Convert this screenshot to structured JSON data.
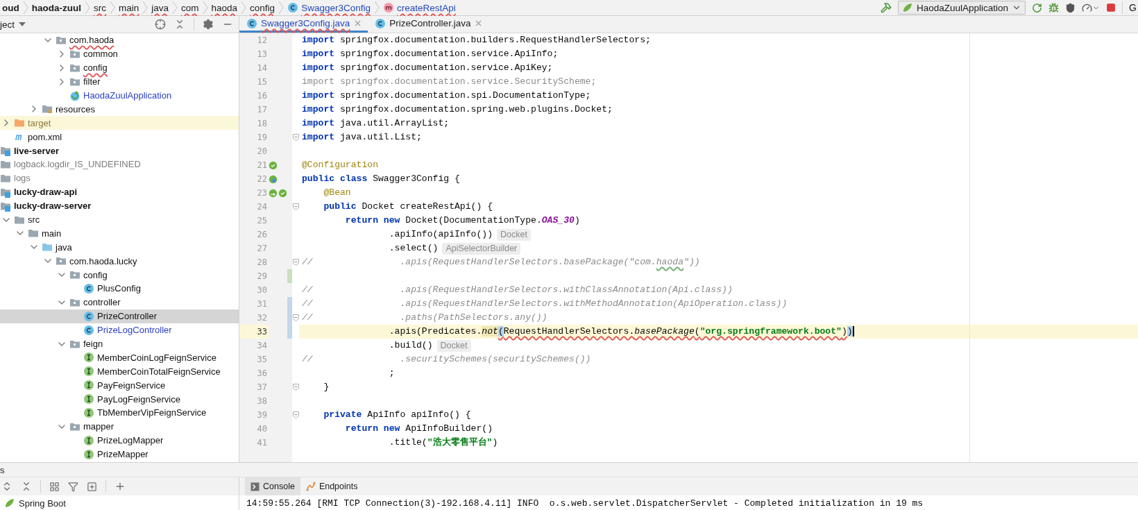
{
  "breadcrumbs": [
    {
      "label": "oud",
      "kind": "module",
      "error": false
    },
    {
      "label": "haoda-zuul",
      "kind": "module",
      "error": false
    },
    {
      "label": "src",
      "kind": "folder",
      "error": true
    },
    {
      "label": "main",
      "kind": "folder",
      "error": true
    },
    {
      "label": "java",
      "kind": "folder",
      "error": true
    },
    {
      "label": "com",
      "kind": "folder",
      "error": true
    },
    {
      "label": "haoda",
      "kind": "folder",
      "error": true
    },
    {
      "label": "config",
      "kind": "folder",
      "error": true
    },
    {
      "label": "Swagger3Config",
      "kind": "class",
      "error": true
    },
    {
      "label": "createRestApi",
      "kind": "method",
      "error": true
    }
  ],
  "run_toolbar": {
    "configuration": "HaodaZuulApplication",
    "overflow_text": "G"
  },
  "project_panel": {
    "title": "ject",
    "tree": [
      {
        "children": [
          {
            "children": [
              {
                "children": [
                  {
                    "children": [
                      {
                        "label": "com.haoda",
                        "kind": "package",
                        "expanded": true,
                        "selected": false,
                        "modified": false,
                        "ignored": false,
                        "dimmed": false,
                        "error": true,
                        "children": [
                          {
                            "label": "common",
                            "kind": "package",
                            "expanded": false,
                            "selected": false,
                            "modified": false,
                            "ignored": false,
                            "dimmed": false,
                            "error": false
                          },
                          {
                            "label": "config",
                            "kind": "package",
                            "expanded": false,
                            "selected": false,
                            "modified": false,
                            "ignored": false,
                            "dimmed": false,
                            "error": true
                          },
                          {
                            "label": "filter",
                            "kind": "package",
                            "expanded": false,
                            "selected": false,
                            "modified": false,
                            "ignored": false,
                            "dimmed": false,
                            "error": false
                          },
                          {
                            "label": "HaodaZuulApplication",
                            "kind": "spring-class",
                            "selected": false,
                            "modified": true,
                            "ignored": false,
                            "dimmed": false,
                            "error": false
                          }
                        ]
                      }
                    ]
                  },
                  {
                    "label": "resources",
                    "kind": "resources-folder",
                    "expanded": false,
                    "selected": false,
                    "modified": false,
                    "ignored": false,
                    "dimmed": false,
                    "error": false
                  }
                ]
              }
            ]
          },
          {
            "label": "target",
            "kind": "excluded-folder",
            "expanded": false,
            "selected": false,
            "modified": false,
            "ignored": true,
            "dimmed": false,
            "error": false
          },
          {
            "label": "pom.xml",
            "kind": "maven",
            "selected": false,
            "modified": false,
            "ignored": false,
            "dimmed": false,
            "error": false
          }
        ]
      },
      {
        "label": "live-server",
        "kind": "module",
        "selected": false,
        "modified": false,
        "ignored": false,
        "dimmed": false,
        "error": false
      },
      {
        "label": "logback.logdir_IS_UNDEFINED",
        "kind": "folder",
        "selected": false,
        "modified": false,
        "ignored": false,
        "dimmed": true,
        "error": false
      },
      {
        "label": "logs",
        "kind": "folder",
        "selected": false,
        "modified": false,
        "ignored": false,
        "dimmed": true,
        "error": false
      },
      {
        "label": "lucky-draw-api",
        "kind": "module",
        "selected": false,
        "modified": false,
        "ignored": false,
        "dimmed": false,
        "error": false
      },
      {
        "label": "lucky-draw-server",
        "kind": "module",
        "selected": false,
        "modified": false,
        "ignored": false,
        "dimmed": false,
        "error": false,
        "children": [
          {
            "label": "src",
            "kind": "folder",
            "expanded": true,
            "selected": false,
            "modified": false,
            "ignored": false,
            "dimmed": false,
            "error": false,
            "children": [
              {
                "label": "main",
                "kind": "folder",
                "expanded": true,
                "selected": false,
                "modified": false,
                "ignored": false,
                "dimmed": false,
                "error": false,
                "children": [
                  {
                    "label": "java",
                    "kind": "source-folder",
                    "expanded": true,
                    "selected": false,
                    "modified": false,
                    "ignored": false,
                    "dimmed": false,
                    "error": false,
                    "children": [
                      {
                        "label": "com.haoda.lucky",
                        "kind": "package",
                        "expanded": true,
                        "selected": false,
                        "modified": false,
                        "ignored": false,
                        "dimmed": false,
                        "error": false,
                        "children": [
                          {
                            "label": "config",
                            "kind": "package",
                            "expanded": true,
                            "selected": false,
                            "modified": false,
                            "ignored": false,
                            "dimmed": false,
                            "error": false,
                            "children": [
                              {
                                "label": "PlusConfig",
                                "kind": "class",
                                "selected": false,
                                "modified": false,
                                "ignored": false,
                                "dimmed": false,
                                "error": false
                              }
                            ]
                          },
                          {
                            "label": "controller",
                            "kind": "package",
                            "expanded": true,
                            "selected": false,
                            "modified": false,
                            "ignored": false,
                            "dimmed": false,
                            "error": false,
                            "children": [
                              {
                                "label": "PrizeController",
                                "kind": "class",
                                "selected": true,
                                "modified": false,
                                "ignored": false,
                                "dimmed": false,
                                "error": false
                              },
                              {
                                "label": "PrizeLogController",
                                "kind": "class",
                                "selected": false,
                                "modified": true,
                                "ignored": false,
                                "dimmed": false,
                                "error": false
                              }
                            ]
                          },
                          {
                            "label": "feign",
                            "kind": "package",
                            "expanded": true,
                            "selected": false,
                            "modified": false,
                            "ignored": false,
                            "dimmed": false,
                            "error": false,
                            "children": [
                              {
                                "label": "MemberCoinLogFeignService",
                                "kind": "interface",
                                "selected": false,
                                "modified": false,
                                "ignored": false,
                                "dimmed": false,
                                "error": false
                              },
                              {
                                "label": "MemberCoinTotalFeignService",
                                "kind": "interface",
                                "selected": false,
                                "modified": false,
                                "ignored": false,
                                "dimmed": false,
                                "error": false
                              },
                              {
                                "label": "PayFeignService",
                                "kind": "interface",
                                "selected": false,
                                "modified": false,
                                "ignored": false,
                                "dimmed": false,
                                "error": false
                              },
                              {
                                "label": "PayLogFeignService",
                                "kind": "interface",
                                "selected": false,
                                "modified": false,
                                "ignored": false,
                                "dimmed": false,
                                "error": false
                              },
                              {
                                "label": "TbMemberVipFeignService",
                                "kind": "interface",
                                "selected": false,
                                "modified": false,
                                "ignored": false,
                                "dimmed": false,
                                "error": false
                              }
                            ]
                          },
                          {
                            "label": "mapper",
                            "kind": "package",
                            "expanded": true,
                            "selected": false,
                            "modified": false,
                            "ignored": false,
                            "dimmed": false,
                            "error": false,
                            "children": [
                              {
                                "label": "PrizeLogMapper",
                                "kind": "interface",
                                "selected": false,
                                "modified": false,
                                "ignored": false,
                                "dimmed": false,
                                "error": false
                              },
                              {
                                "label": "PrizeMapper",
                                "kind": "interface",
                                "selected": false,
                                "modified": false,
                                "ignored": false,
                                "dimmed": false,
                                "error": false
                              }
                            ]
                          }
                        ]
                      }
                    ]
                  }
                ]
              }
            ]
          }
        ]
      }
    ]
  },
  "editor": {
    "tabs": [
      {
        "label": "Swagger3Config.java",
        "kind": "class",
        "selected": true,
        "error": true
      },
      {
        "label": "PrizeController.java",
        "kind": "class",
        "selected": false,
        "error": false
      }
    ],
    "lines": [
      {
        "number": "12",
        "kind": "plain",
        "tokens": [
          {
            "kind": "keyword",
            "text": "import"
          },
          {
            "kind": "plain",
            "text": " springfox.documentation.builders.RequestHandlerSelectors;"
          }
        ]
      },
      {
        "number": "13",
        "kind": "plain",
        "tokens": [
          {
            "kind": "keyword",
            "text": "import"
          },
          {
            "kind": "plain",
            "text": " springfox.documentation.service.ApiInfo;"
          }
        ]
      },
      {
        "number": "14",
        "kind": "plain",
        "tokens": [
          {
            "kind": "keyword",
            "text": "import"
          },
          {
            "kind": "plain",
            "text": " springfox.documentation.service.ApiKey;"
          }
        ]
      },
      {
        "number": "15",
        "kind": "plain",
        "tokens": [
          {
            "kind": "unused",
            "text": "import springfox.documentation.service.SecurityScheme;"
          }
        ]
      },
      {
        "number": "16",
        "kind": "plain",
        "tokens": [
          {
            "kind": "keyword",
            "text": "import"
          },
          {
            "kind": "plain",
            "text": " springfox.documentation.spi.DocumentationType;"
          }
        ]
      },
      {
        "number": "17",
        "kind": "plain",
        "tokens": [
          {
            "kind": "keyword",
            "text": "import"
          },
          {
            "kind": "plain",
            "text": " springfox.documentation.spring.web.plugins.Docket;"
          }
        ]
      },
      {
        "number": "18",
        "kind": "plain",
        "tokens": [
          {
            "kind": "keyword",
            "text": "import"
          },
          {
            "kind": "plain",
            "text": " java.util.ArrayList;"
          }
        ]
      },
      {
        "number": "19",
        "kind": "plain",
        "fold": true,
        "tokens": [
          {
            "kind": "keyword",
            "text": "import"
          },
          {
            "kind": "plain",
            "text": " java.util.List;"
          }
        ]
      },
      {
        "number": "20",
        "kind": "plain"
      },
      {
        "number": "21",
        "kind": "plain",
        "gutter": [
          {
            "kind": "spring-config"
          }
        ],
        "tokens": [
          {
            "kind": "annotation",
            "text": "@Configuration"
          }
        ]
      },
      {
        "number": "22",
        "kind": "plain",
        "gutter": [
          {
            "kind": "spring-bean"
          }
        ],
        "tokens": [
          {
            "kind": "keyword",
            "text": "public class"
          },
          {
            "kind": "plain",
            "text": " Swagger3Config {"
          }
        ]
      },
      {
        "number": "23",
        "kind": "plain",
        "gutter": [
          {
            "kind": "bean-link"
          },
          {
            "kind": "spring-config"
          }
        ],
        "tokens": [
          {
            "kind": "annotation",
            "text": "    @Bean"
          }
        ]
      },
      {
        "number": "24",
        "kind": "plain",
        "fold": true,
        "tokens": [
          {
            "kind": "keyword",
            "text": "    public"
          },
          {
            "kind": "plain",
            "text": " Docket createRestApi() {"
          }
        ]
      },
      {
        "number": "25",
        "kind": "plain",
        "tokens": [
          {
            "kind": "keyword",
            "text": "        return new"
          },
          {
            "kind": "plain",
            "text": " Docket(DocumentationType."
          },
          {
            "kind": "static-field",
            "text": "OAS_30"
          },
          {
            "kind": "plain",
            "text": ")"
          }
        ]
      },
      {
        "number": "26",
        "kind": "plain",
        "tokens": [
          {
            "kind": "plain",
            "text": "                .apiInfo(apiInfo())"
          }
        ],
        "hint": "Docket"
      },
      {
        "number": "27",
        "kind": "plain",
        "tokens": [
          {
            "kind": "plain",
            "text": "                .select()"
          }
        ],
        "hint": "ApiSelectorBuilder"
      },
      {
        "number": "28",
        "kind": "plain",
        "fold": true,
        "tokens": [
          {
            "kind": "comment",
            "text": "//                .apis(RequestHandlerSelectors.basePackage(\"com."
          },
          {
            "kind": "comment-typo",
            "text": "haoda"
          },
          {
            "kind": "comment",
            "text": "\"))"
          }
        ]
      },
      {
        "number": "29",
        "kind": "added"
      },
      {
        "number": "30",
        "kind": "plain",
        "tokens": [
          {
            "kind": "comment",
            "text": "//                .apis(RequestHandlerSelectors.withClassAnnotation(Api.class))"
          }
        ]
      },
      {
        "number": "31",
        "kind": "modified",
        "tokens": [
          {
            "kind": "comment",
            "text": "//                .apis(RequestHandlerSelectors.withMethodAnnotation(ApiOperation.class))"
          }
        ]
      },
      {
        "number": "32",
        "kind": "modified",
        "fold": true,
        "tokens": [
          {
            "kind": "comment",
            "text": "//                .paths(PathSelectors.any())"
          }
        ]
      },
      {
        "number": "33",
        "kind": "modified",
        "current": true,
        "tokens": [
          {
            "kind": "plain",
            "text": "                .apis(Predicates."
          },
          {
            "kind": "static-method-usage",
            "text": "not"
          },
          {
            "kind": "brace-error",
            "text": "("
          },
          {
            "kind": "plain-error",
            "text": "RequestHandlerSelectors."
          },
          {
            "kind": "static-method-error",
            "text": "basePackage"
          },
          {
            "kind": "plain-error",
            "text": "("
          },
          {
            "kind": "string-error",
            "text": "\"org.springframework.boot\""
          },
          {
            "kind": "plain-error",
            "text": ")"
          },
          {
            "kind": "brace-caret",
            "text": ")"
          }
        ]
      },
      {
        "number": "34",
        "kind": "plain",
        "tokens": [
          {
            "kind": "plain",
            "text": "                .build()"
          }
        ],
        "hint": "Docket"
      },
      {
        "number": "35",
        "kind": "plain",
        "tokens": [
          {
            "kind": "comment",
            "text": "//                .securitySchemes(securitySchemes())"
          }
        ]
      },
      {
        "number": "36",
        "kind": "plain",
        "tokens": [
          {
            "kind": "plain",
            "text": "                ;"
          }
        ]
      },
      {
        "number": "37",
        "kind": "plain",
        "fold": true,
        "tokens": [
          {
            "kind": "plain",
            "text": "    }"
          }
        ]
      },
      {
        "number": "38",
        "kind": "plain"
      },
      {
        "number": "39",
        "kind": "plain",
        "fold": true,
        "tokens": [
          {
            "kind": "keyword",
            "text": "    private"
          },
          {
            "kind": "plain",
            "text": " ApiInfo apiInfo() {"
          }
        ]
      },
      {
        "number": "40",
        "kind": "plain",
        "tokens": [
          {
            "kind": "keyword",
            "text": "        return new"
          },
          {
            "kind": "plain",
            "text": " ApiInfoBuilder()"
          }
        ]
      },
      {
        "number": "41",
        "kind": "plain",
        "tokens": [
          {
            "kind": "plain",
            "text": "                .title("
          },
          {
            "kind": "string",
            "text": "\"浩大零售平台\""
          },
          {
            "kind": "plain",
            "text": ")"
          }
        ]
      }
    ]
  },
  "services_panel": {
    "title": "s",
    "items": [
      {
        "label": "Spring Boot",
        "kind": "spring"
      }
    ]
  },
  "console": {
    "tabs": [
      {
        "label": "Console",
        "kind": "console",
        "selected": true
      },
      {
        "label": "Endpoints",
        "kind": "endpoints",
        "selected": false
      }
    ],
    "output": [
      "14:59:55.264 [RMI TCP Connection(3)-192.168.4.11] INFO  o.s.web.servlet.DispatcherServlet - Completed initialization in 19 ms"
    ]
  }
}
